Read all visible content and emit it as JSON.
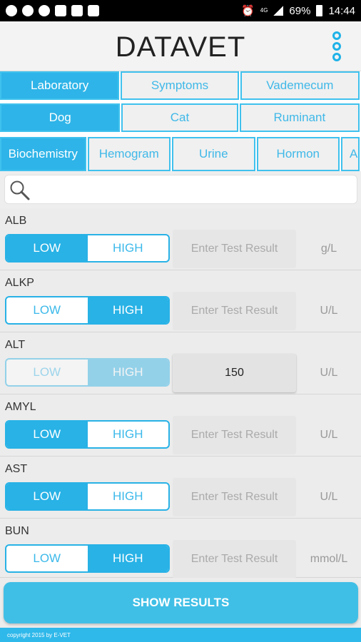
{
  "status_bar": {
    "network_label": "4G",
    "battery": "69%",
    "time": "14:44"
  },
  "header": {
    "logo": "DATAVET",
    "menu_icon": "kebab-menu-icon"
  },
  "tabs_top": [
    {
      "label": "Laboratory",
      "active": true
    },
    {
      "label": "Symptoms",
      "active": false
    },
    {
      "label": "Vademecum",
      "active": false
    }
  ],
  "tabs_species": [
    {
      "label": "Dog",
      "active": true
    },
    {
      "label": "Cat",
      "active": false
    },
    {
      "label": "Ruminant",
      "active": false
    }
  ],
  "tabs_category": [
    {
      "label": "Biochemistry",
      "active": true
    },
    {
      "label": "Hemogram",
      "active": false
    },
    {
      "label": "Urine",
      "active": false
    },
    {
      "label": "Hormon",
      "active": false
    },
    {
      "label": "A",
      "active": false
    }
  ],
  "search": {
    "placeholder": "",
    "value": ""
  },
  "tests": [
    {
      "name": "ALB",
      "low": "LOW",
      "high": "HIGH",
      "selected": "low",
      "result": "",
      "placeholder": "Enter Test Result",
      "unit": "g/L"
    },
    {
      "name": "ALKP",
      "low": "LOW",
      "high": "HIGH",
      "selected": "high",
      "result": "",
      "placeholder": "Enter Test Result",
      "unit": "U/L"
    },
    {
      "name": "ALT",
      "low": "LOW",
      "high": "HIGH",
      "selected": "high-disabled",
      "result": "150",
      "placeholder": "",
      "unit": "U/L"
    },
    {
      "name": "AMYL",
      "low": "LOW",
      "high": "HIGH",
      "selected": "low",
      "result": "",
      "placeholder": "Enter Test Result",
      "unit": "U/L"
    },
    {
      "name": "AST",
      "low": "LOW",
      "high": "HIGH",
      "selected": "low",
      "result": "",
      "placeholder": "Enter Test Result",
      "unit": "U/L"
    },
    {
      "name": "BUN",
      "low": "LOW",
      "high": "HIGH",
      "selected": "high",
      "result": "",
      "placeholder": "Enter Test Result",
      "unit": "mmol/L"
    }
  ],
  "show_results_label": "SHOW RESULTS",
  "footer": "copyright 2015 by E-VET",
  "colors": {
    "accent": "#2eb4e8",
    "background": "#ececec"
  }
}
